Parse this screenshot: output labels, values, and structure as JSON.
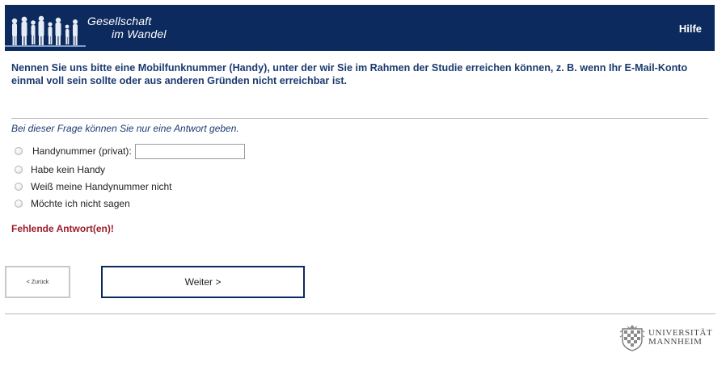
{
  "header": {
    "logo_line1": "Gesellschaft",
    "logo_line2": "im Wandel",
    "help_label": "Hilfe"
  },
  "question": {
    "text": "Nennen Sie uns bitte eine Mobilfunknummer (Handy), unter der wir Sie im Rahmen der Studie erreichen können, z. B. wenn Ihr E-Mail-Konto einmal voll sein sollte oder aus anderen Gründen nicht erreichbar ist.",
    "instruction": "Bei dieser Frage können Sie nur eine Antwort geben.",
    "options": [
      {
        "label": "Handynummer (privat):",
        "input_value": ""
      },
      {
        "label": "Habe kein Handy"
      },
      {
        "label": "Weiß meine Handynummer nicht"
      },
      {
        "label": "Möchte ich nicht sagen"
      }
    ],
    "error": "Fehlende Antwort(en)!"
  },
  "nav": {
    "back_label": "< Zurück",
    "next_label": "Weiter >"
  },
  "footer": {
    "university_line1": "UNIVERSITÄT",
    "university_line2": "MANNHEIM"
  }
}
